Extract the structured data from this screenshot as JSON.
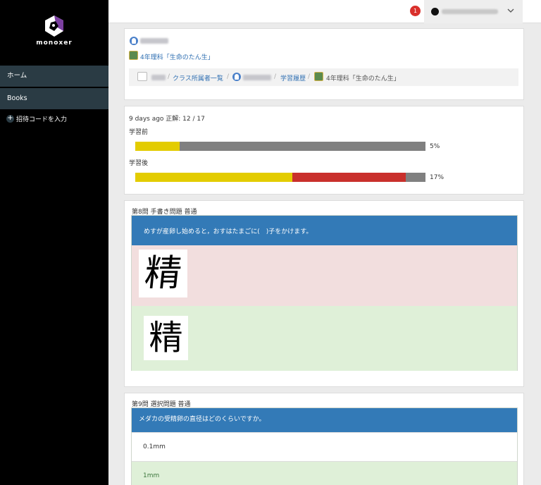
{
  "sidebar": {
    "logo_text": "monoxer",
    "items": [
      {
        "label": "ホーム"
      },
      {
        "label": "Books"
      }
    ],
    "invite_label": "招待コードを入力"
  },
  "topbar": {
    "notification_count": "1"
  },
  "header_card": {
    "book_title": "4年理科「生命のたん生」",
    "breadcrumb": {
      "class_list": "クラス所属者一覧",
      "history": "学習履歴",
      "book": "4年理科「生命のたん生」"
    }
  },
  "stats_card": {
    "summary": "9 days ago 正解: 12 / 17",
    "before_label": "学習前",
    "after_label": "学習後",
    "before_pct": "5%",
    "after_pct": "17%",
    "before_bar": {
      "yellow": 0.153,
      "red": 0.0
    },
    "after_bar": {
      "yellow": 0.541,
      "red": 0.392
    },
    "colors": {
      "yellow": "#e3cc00",
      "red": "#c9302c",
      "gray": "#808080"
    }
  },
  "question8": {
    "title": "第8問 手書き問題 普通",
    "text": "めすが産卵し始めると，おすはたまごに(　)子をかけます。",
    "user_answer": "精",
    "correct_answer": "精"
  },
  "question9": {
    "title": "第9問 選択問題 普通",
    "text": "メダカの受精卵の直径はどのくらいですか。",
    "options": [
      "0.1mm",
      "1mm"
    ]
  }
}
